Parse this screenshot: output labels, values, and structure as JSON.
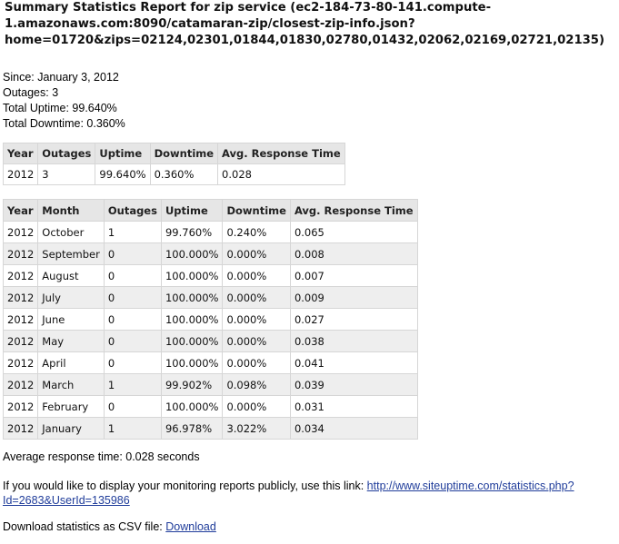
{
  "title": "Summary Statistics Report for zip service (ec2-184-73-80-141.compute-1.amazonaws.com:8090/catamaran-zip/closest-zip-info.json?home=01720&zips=02124,02301,01844,01830,02780,01432,02062,02169,02721,02135)",
  "stats": {
    "since": "Since: January 3, 2012",
    "outages": "Outages: 3",
    "total_uptime": "Total Uptime: 99.640%",
    "total_downtime": "Total Downtime: 0.360%"
  },
  "summary_table": {
    "headers": [
      "Year",
      "Outages",
      "Uptime",
      "Downtime",
      "Avg. Response Time"
    ],
    "rows": [
      [
        "2012",
        "3",
        "99.640%",
        "0.360%",
        "0.028"
      ]
    ]
  },
  "monthly_table": {
    "headers": [
      "Year",
      "Month",
      "Outages",
      "Uptime",
      "Downtime",
      "Avg. Response Time"
    ],
    "rows": [
      [
        "2012",
        "October",
        "1",
        "99.760%",
        "0.240%",
        "0.065"
      ],
      [
        "2012",
        "September",
        "0",
        "100.000%",
        "0.000%",
        "0.008"
      ],
      [
        "2012",
        "August",
        "0",
        "100.000%",
        "0.000%",
        "0.007"
      ],
      [
        "2012",
        "July",
        "0",
        "100.000%",
        "0.000%",
        "0.009"
      ],
      [
        "2012",
        "June",
        "0",
        "100.000%",
        "0.000%",
        "0.027"
      ],
      [
        "2012",
        "May",
        "0",
        "100.000%",
        "0.000%",
        "0.038"
      ],
      [
        "2012",
        "April",
        "0",
        "100.000%",
        "0.000%",
        "0.041"
      ],
      [
        "2012",
        "March",
        "1",
        "99.902%",
        "0.098%",
        "0.039"
      ],
      [
        "2012",
        "February",
        "0",
        "100.000%",
        "0.000%",
        "0.031"
      ],
      [
        "2012",
        "January",
        "1",
        "96.978%",
        "3.022%",
        "0.034"
      ]
    ]
  },
  "avg_response": "Average response time: 0.028 seconds",
  "public_link": {
    "text": "If you would like to display your monitoring reports publicly, use this link:",
    "url": "http://www.siteuptime.com/statistics.php?Id=2683&UserId=135986"
  },
  "csv": {
    "text": "Download statistics as CSV file:",
    "link_label": "Download"
  },
  "colors": {
    "header_bg": "#e6e6e6",
    "alt_row_bg": "#eeeeee",
    "border": "#d6d6d6",
    "link": "#1f3c9a"
  }
}
